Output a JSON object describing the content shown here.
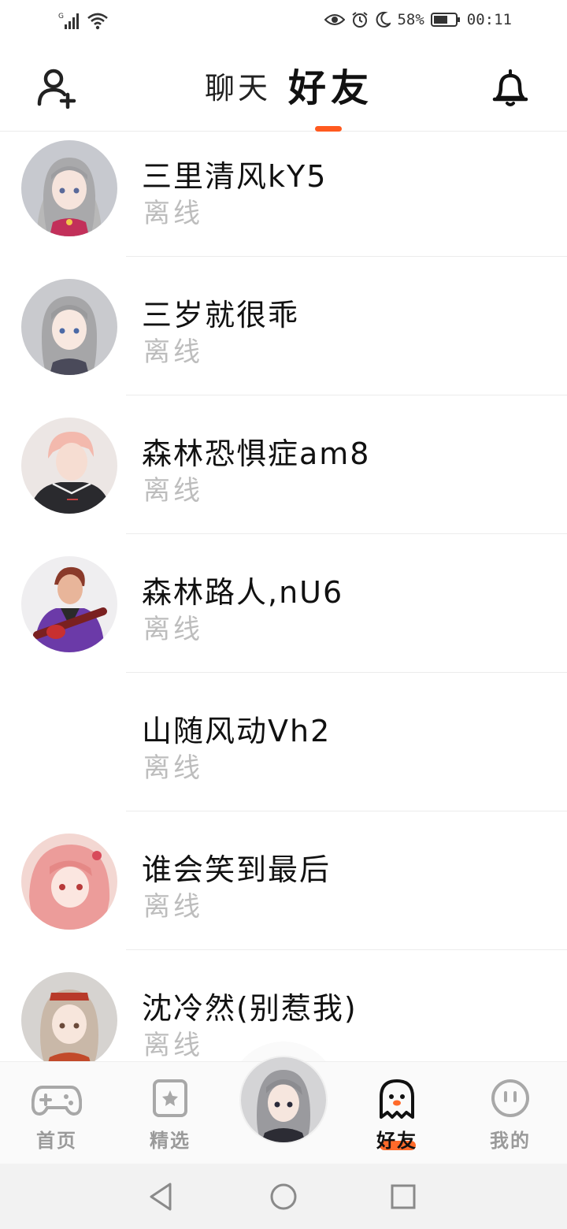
{
  "status_bar": {
    "network_label": "G",
    "battery_percent": "58%",
    "time": "00:11",
    "icons": [
      "signal-icon",
      "wifi-icon",
      "eye-icon",
      "alarm-icon",
      "moon-icon",
      "battery-icon"
    ]
  },
  "header": {
    "tab_chat": "聊天",
    "tab_friends": "好友",
    "active_tab": "好友",
    "accent_color": "#ff5a1f",
    "left_icon": "add-friend-icon",
    "right_icon": "bell-icon"
  },
  "friends": [
    {
      "name": "三里清风kY5",
      "status": "离线",
      "has_avatar": true,
      "avatar_theme": "grey-hair-girl-pink"
    },
    {
      "name": "三岁就很乖",
      "status": "离线",
      "has_avatar": true,
      "avatar_theme": "grey-hair-girl"
    },
    {
      "name": "森林恐惧症am8",
      "status": "离线",
      "has_avatar": true,
      "avatar_theme": "pink-hair-boy"
    },
    {
      "name": "森林路人,nU6",
      "status": "离线",
      "has_avatar": true,
      "avatar_theme": "guitar-boy"
    },
    {
      "name": "山随风动Vh2",
      "status": "离线",
      "has_avatar": false
    },
    {
      "name": "谁会笑到最后",
      "status": "离线",
      "has_avatar": true,
      "avatar_theme": "pink-hair-girl"
    },
    {
      "name": "沈冷然(别惹我)",
      "status": "离线",
      "has_avatar": true,
      "avatar_theme": "brown-hair-girl"
    }
  ],
  "bottom_nav": {
    "items": [
      {
        "label": "首页",
        "icon": "gamepad-icon",
        "active": false
      },
      {
        "label": "精选",
        "icon": "star-icon",
        "active": false
      },
      {
        "label": "好友",
        "icon": "ghost-icon",
        "active": true
      },
      {
        "label": "我的",
        "icon": "smiley-icon",
        "active": false
      }
    ],
    "center_icon": "profile-avatar"
  },
  "system_nav": {
    "icons": [
      "back-icon",
      "home-icon",
      "recents-icon"
    ]
  }
}
